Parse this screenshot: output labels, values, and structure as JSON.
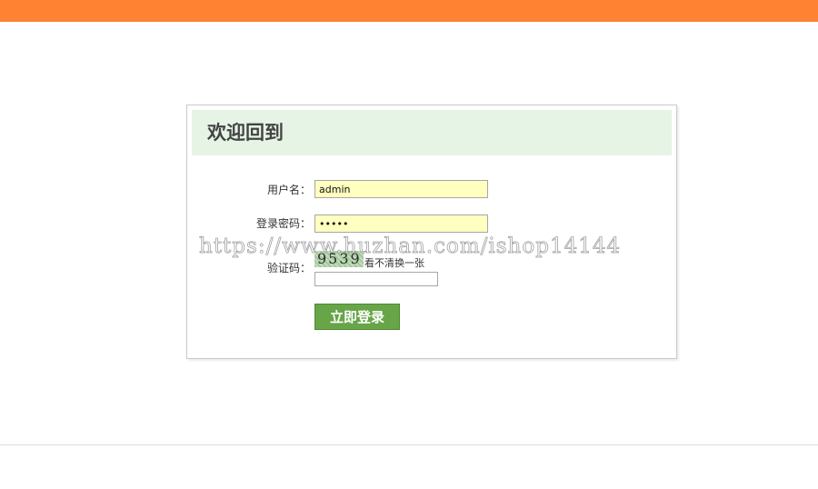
{
  "colors": {
    "top_bar": "#ff8132",
    "header_bg": "#e6f4e6",
    "input_bg": "#ffffc0",
    "button_bg": "#67a548"
  },
  "login": {
    "title": "欢迎回到",
    "username": {
      "label": "用户名：",
      "value": "admin"
    },
    "password": {
      "label": "登录密码：",
      "value": "12345"
    },
    "captcha": {
      "label": "验证码：",
      "image_text": "9539",
      "refresh_label": "看不清换一张",
      "value": ""
    },
    "submit_label": "立即登录"
  },
  "watermark": "https://www.huzhan.com/ishop14144"
}
